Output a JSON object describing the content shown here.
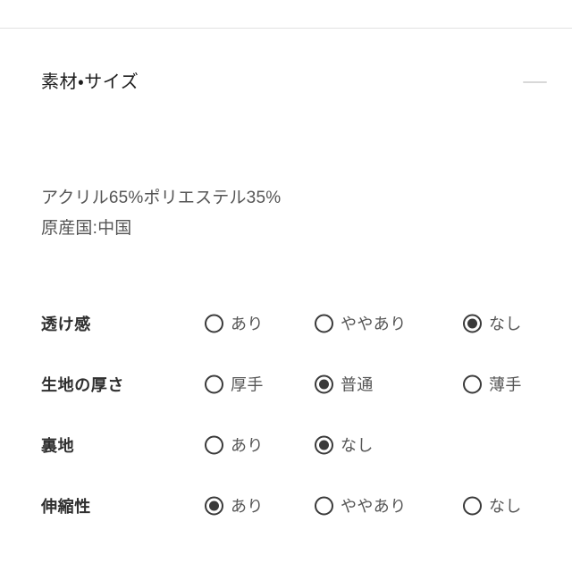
{
  "section": {
    "title": "素材・サイズ",
    "collapse_icon": "minus-icon",
    "expanded": true
  },
  "material_info": {
    "lines": [
      "アクリル65%ポリエステル35%",
      "原産国:中国"
    ]
  },
  "specs": {
    "rows": [
      {
        "label": "透け感",
        "options": [
          {
            "label": "あり",
            "selected": false
          },
          {
            "label": "ややあり",
            "selected": false
          },
          {
            "label": "なし",
            "selected": true
          }
        ]
      },
      {
        "label": "生地の厚さ",
        "options": [
          {
            "label": "厚手",
            "selected": false
          },
          {
            "label": "普通",
            "selected": true
          },
          {
            "label": "薄手",
            "selected": false
          }
        ]
      },
      {
        "label": "裏地",
        "options": [
          {
            "label": "あり",
            "selected": false
          },
          {
            "label": "なし",
            "selected": true
          }
        ]
      },
      {
        "label": "伸縮性",
        "options": [
          {
            "label": "あり",
            "selected": true
          },
          {
            "label": "ややあり",
            "selected": false
          },
          {
            "label": "なし",
            "selected": false
          }
        ]
      }
    ]
  },
  "colors": {
    "text_dark": "#2f2f2f",
    "text_gray": "#555555",
    "rule": "#e2e2e2",
    "radio": "#3a3a3a",
    "background": "#ffffff"
  }
}
